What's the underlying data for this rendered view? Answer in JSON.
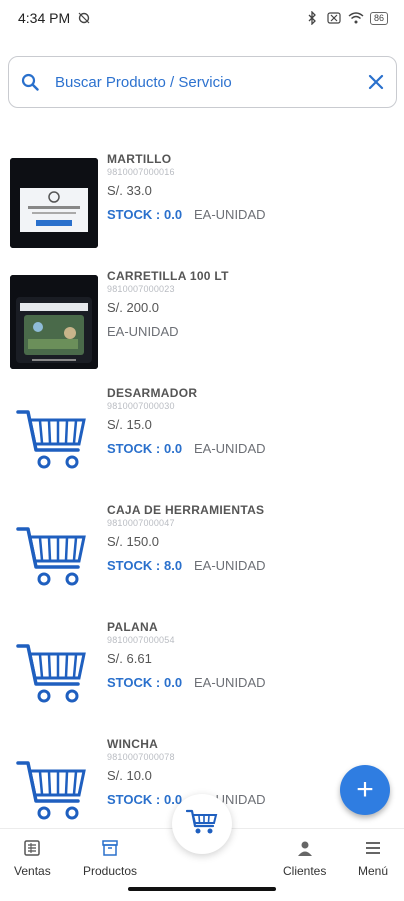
{
  "status": {
    "time": "4:34 PM",
    "battery": "86"
  },
  "search": {
    "placeholder": "Buscar Producto / Servicio"
  },
  "products": [
    {
      "name": "MARTILLO",
      "code": "9810007000016",
      "price": "S/. 33.0",
      "stock_label": "STOCK :",
      "stock": "0.0",
      "unit": "EA-UNIDAD",
      "image": "screenshot-thumbnail"
    },
    {
      "name": "CARRETILLA 100 LT",
      "code": "9810007000023",
      "price": "S/. 200.0",
      "unit": "EA-UNIDAD",
      "image": "screenshot-thumbnail"
    },
    {
      "name": "DESARMADOR",
      "code": "9810007000030",
      "price": "S/. 15.0",
      "stock_label": "STOCK :",
      "stock": "0.0",
      "unit": "EA-UNIDAD",
      "image": "shopping-cart-icon"
    },
    {
      "name": "CAJA DE HERRAMIENTAS",
      "code": "9810007000047",
      "price": "S/. 150.0",
      "stock_label": "STOCK :",
      "stock": "8.0",
      "unit": "EA-UNIDAD",
      "image": "shopping-cart-icon"
    },
    {
      "name": "PALANA",
      "code": "9810007000054",
      "price": "S/. 6.61",
      "stock_label": "STOCK :",
      "stock": "0.0",
      "unit": "EA-UNIDAD",
      "image": "shopping-cart-icon"
    },
    {
      "name": "WINCHA",
      "code": "9810007000078",
      "price": "S/. 10.0",
      "stock_label": "STOCK :",
      "stock": "0.0",
      "unit": "EA-UNIDAD",
      "image": "shopping-cart-icon"
    }
  ],
  "fab": {
    "symbol": "+"
  },
  "nav": {
    "ventas": "Ventas",
    "productos": "Productos",
    "clientes": "Clientes",
    "menu": "Menú"
  },
  "colors": {
    "accent": "#2f7de1",
    "text_blue": "#2a70cc"
  }
}
